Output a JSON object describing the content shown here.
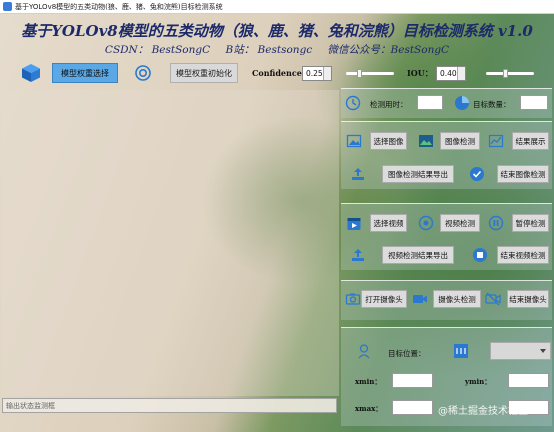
{
  "window": {
    "title": "基于YOLOv8模型的五类动物(狼、鹿、猪、兔和浣熊)目标检测系统"
  },
  "header": {
    "title": "基于YOLOv8模型的五类动物（狼、鹿、猪、兔和浣熊）目标检测系统 v1.0",
    "csdn": "CSDN：  BestSongC",
    "bili": "B站：  Bestsongc",
    "wechat": "微信公众号：BestSongC"
  },
  "toolbar": {
    "select_weights": "模型权重选择",
    "init_weights": "模型权重初始化",
    "confidence_label": "Confidence",
    "confidence_value": "0.25",
    "confidence_level": 0.25,
    "iou_label": "IOU：",
    "iou_value": "0.40",
    "iou_level": 0.4
  },
  "stats": {
    "time_label": "检测用时：",
    "count_label": "目标数量："
  },
  "image_section": {
    "select_image": "选择图像",
    "image_detect": "图像检测",
    "show_result": "结果展示",
    "export": "图像检测结果导出",
    "end": "结束图像检测"
  },
  "video_section": {
    "select_video": "选择视频",
    "video_detect": "视频检测",
    "pause": "暂停检测",
    "export": "视频检测结果导出",
    "end": "结束视频检测"
  },
  "camera_section": {
    "open_camera": "打开摄像头",
    "camera_detect": "摄像头检测",
    "close_camera": "结束摄像头"
  },
  "target_section": {
    "position_label": "目标位置：",
    "xmin": "xmin：",
    "ymin": "ymin：",
    "xmax": "xmax："
  },
  "log": {
    "placeholder": "输出状态监测框"
  },
  "watermark": "@稀土掘金技术社区",
  "colors": {
    "title_text": "#1c2a6a",
    "accent_button": "#5aa8e6",
    "icon_blue": "#2a78d0"
  }
}
